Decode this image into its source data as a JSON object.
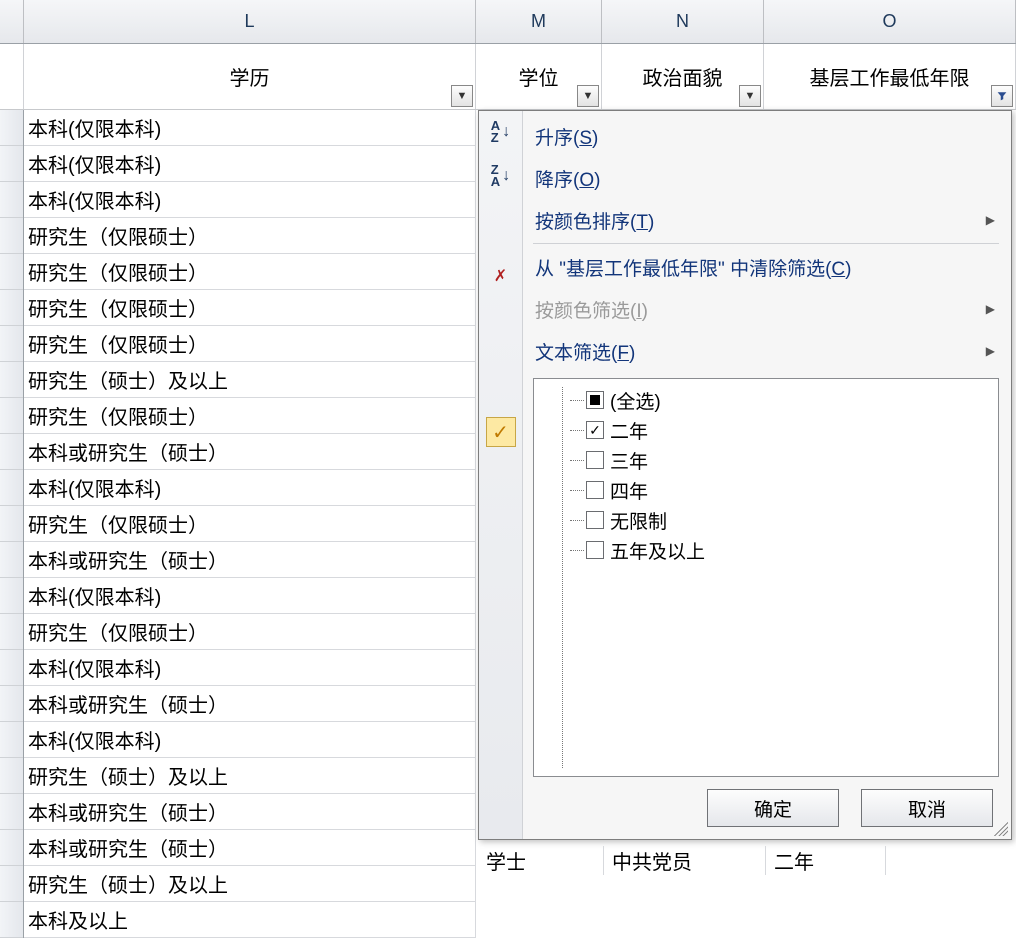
{
  "columns": {
    "L": {
      "letter": "L",
      "header": "学历"
    },
    "M": {
      "letter": "M",
      "header": "学位"
    },
    "N": {
      "letter": "N",
      "header": "政治面貌"
    },
    "O": {
      "letter": "O",
      "header": "基层工作最低年限",
      "filter_active": true
    }
  },
  "rows_L": [
    "本科(仅限本科)",
    "本科(仅限本科)",
    "本科(仅限本科)",
    "研究生（仅限硕士）",
    "研究生（仅限硕士）",
    "研究生（仅限硕士）",
    "研究生（仅限硕士）",
    "研究生（硕士）及以上",
    "研究生（仅限硕士）",
    "本科或研究生（硕士）",
    "本科(仅限本科)",
    "研究生（仅限硕士）",
    "本科或研究生（硕士）",
    "本科(仅限本科)",
    "研究生（仅限硕士）",
    "本科(仅限本科)",
    "本科或研究生（硕士）",
    "本科(仅限本科)",
    "研究生（硕士）及以上",
    "本科或研究生（硕士）",
    "本科或研究生（硕士）",
    "研究生（硕士）及以上",
    "本科及以上"
  ],
  "filter_menu": {
    "sort_asc": {
      "label": "升序",
      "mn": "S"
    },
    "sort_desc": {
      "label": "降序",
      "mn": "O"
    },
    "sort_by_color": {
      "label": "按颜色排序",
      "mn": "T"
    },
    "clear_filter": {
      "prefix": "从 \"",
      "colname": "基层工作最低年限",
      "suffix": "\" 中清除筛选",
      "mn": "C"
    },
    "filter_by_color": {
      "label": "按颜色筛选",
      "mn": "I"
    },
    "text_filter": {
      "label": "文本筛选",
      "mn": "F"
    },
    "options": [
      {
        "label": "(全选)",
        "state": "mixed"
      },
      {
        "label": "二年",
        "state": "checked"
      },
      {
        "label": "三年",
        "state": "unchecked"
      },
      {
        "label": "四年",
        "state": "unchecked"
      },
      {
        "label": "无限制",
        "state": "unchecked"
      },
      {
        "label": "五年及以上",
        "state": "unchecked"
      }
    ],
    "ok": "确定",
    "cancel": "取消"
  },
  "bottom_peek": {
    "a": "学士",
    "b": "中共党员",
    "c": "二年"
  }
}
